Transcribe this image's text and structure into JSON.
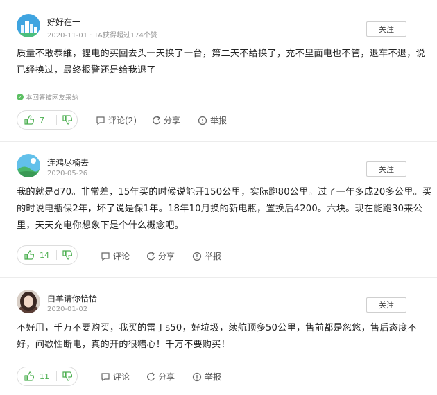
{
  "answers": [
    {
      "username": "好好在一",
      "meta": "2020-11-01 · TA获得超过174个赞",
      "follow_label": "关注",
      "content": "质量不敢恭维，锂电的买回去头一天换了一台，第二天不给换了，充不里面电也不管，退车不退，说已经换过，最终报警还是给我退了",
      "adopted": "本回答被网友采纳",
      "likes": "7",
      "comment_label": "评论(2)",
      "share_label": "分享",
      "report_label": "举报"
    },
    {
      "username": "连鸿尽楠去",
      "meta": "2020-05-26",
      "follow_label": "关注",
      "content": "我的就是d70。非常差，15年买的时候说能开150公里，实际跑80公里。过了一年多成20多公里。买的时说电瓶保2年，坏了说是保1年。18年10月换的新电瓶，置换后4200。六块。现在能跑30来公里，天天充电你想象下是个什么概念吧。",
      "likes": "14",
      "comment_label": "评论",
      "share_label": "分享",
      "report_label": "举报"
    },
    {
      "username": "白羊请你恰恰",
      "meta": "2020-01-02",
      "follow_label": "关注",
      "content": "不好用，千万不要购买，我买的雷丁s50，好垃圾，续航顶多50公里，售前都是忽悠，售后态度不好，间歇性断电，真的开的很糟心！千万不要购买！",
      "likes": "11",
      "comment_label": "评论",
      "share_label": "分享",
      "report_label": "举报"
    }
  ]
}
